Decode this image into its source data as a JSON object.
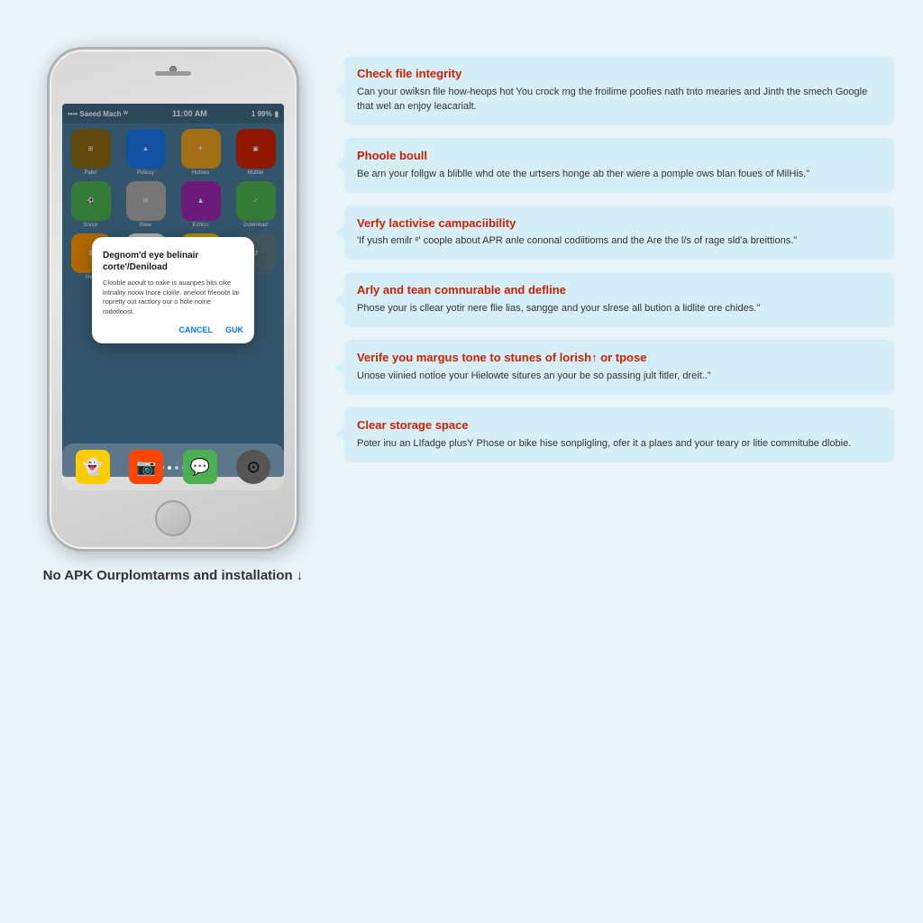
{
  "phone": {
    "status_left": "•••• Saeed Mach  ᵂ",
    "status_time": "11:00 AM",
    "status_right": "1 99%",
    "apps_row1": [
      {
        "label": "Paler",
        "color": "#8b6914",
        "icon": "⊞"
      },
      {
        "label": "Policcy",
        "color": "#1a73e8",
        "icon": "▲"
      },
      {
        "label": "Homes",
        "color": "#e8a020",
        "icon": "✈"
      },
      {
        "label": "Mobile",
        "color": "#cc2200",
        "icon": "▣"
      }
    ],
    "apps_row2": [
      {
        "label": "Socor",
        "color": "#4CAF50",
        "icon": "⚽"
      },
      {
        "label": "INew",
        "color": "#e8e8e8",
        "icon": "✉"
      },
      {
        "label": "Echics",
        "color": "#9c27b0",
        "icon": "♟"
      },
      {
        "label": "Download",
        "color": "#4CAF50",
        "icon": "✓"
      }
    ],
    "apps_row3": [
      {
        "label": "Ilom",
        "color": "#ff9800",
        "icon": "$"
      },
      {
        "label": "",
        "color": "#4285F4",
        "icon": "G"
      },
      {
        "label": "",
        "color": "#ffcc00",
        "icon": "★"
      },
      {
        "label": "",
        "color": "#607d8b",
        "icon": "↺"
      }
    ],
    "dialog": {
      "title": "Degnom'd eye belinair corte'/Deniload",
      "body": "Clooble aooult to nake is auanpes hits cike lntnality noow Inore clolile. aneloot frleoobt lar ropretly out ractlory our o hole noine rodotloost.",
      "cancel_label": "CANCEL",
      "confirm_label": "GUK"
    },
    "caption": "No APK Ourplomtarms and installation ↓"
  },
  "tips": [
    {
      "title": "Check file integrity",
      "body": "Can your owiksn file how-heops hot You crock mg the froilime poofies nath tnto mearies and Jinth the smech Google that wel an enjoy leacarialt."
    },
    {
      "title": "Phoole boull",
      "body": "Be arn your follgw a bliblle whd ote the urtsers honge ab ther wiere a pomple ows blan foues of MilHis.\""
    },
    {
      "title": "Verfy lactivise campaciibility",
      "body": "'If yush emilr ᵉ' coople about APR anle cononal codiitioms and the Are the l/s of rage sld'a breittions.\""
    },
    {
      "title": "Arly and tean comnurable and defline",
      "body": "Phose your is cllear yotir nere flie lias, sangge and your slrese all bution a lidlite ore chides.''"
    },
    {
      "title": "Verife you margus tone to stunes of lorish↑ or tpose",
      "body": "Unose viinied notioe your Hielowte situres an your be so passing jult fitler, dreit..\""
    },
    {
      "title": "Clear storage space",
      "body": "Poter inu an LIfadge plusY Phose or bike hise sonpligling, ofer it a plaes and your teary or litie commitube dlobie."
    }
  ]
}
